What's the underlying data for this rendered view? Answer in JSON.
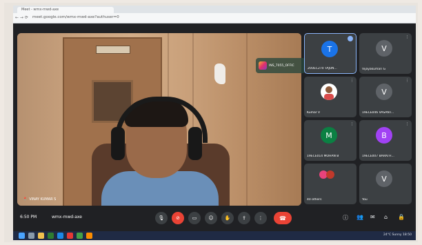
{
  "browser": {
    "tab_title": "Meet - wmx-mwd-axe",
    "url": "meet.google.com/wmx-mwd-axe?authuser=0"
  },
  "main_speaker": {
    "name_label": "VINAY KUMAR S",
    "overlay_label": "INS_7055_OFFIC"
  },
  "participants": [
    {
      "label": "20UEC270 TAJUN...",
      "initial": "T",
      "color": "#1a73e8",
      "speaking": true
    },
    {
      "label": "Vijayakumari G",
      "initial": "V",
      "color": "#5f6368",
      "speaking": false
    },
    {
      "label": "Kumar V",
      "initial": "",
      "color": "#ffffff",
      "speaking": false
    },
    {
      "label": "19ECE046 VASANT...",
      "initial": "V",
      "color": "#5f6368",
      "speaking": false
    },
    {
      "label": "19ECE014 MOHAN B",
      "initial": "M",
      "color": "#0b8043",
      "speaking": false
    },
    {
      "label": "19ECE007 BARATH...",
      "initial": "B",
      "color": "#a142f4",
      "speaking": false
    },
    {
      "label": "40 others",
      "initial": "",
      "color": "#e8437c",
      "speaking": false
    },
    {
      "label": "You",
      "initial": "V",
      "color": "#5f6368",
      "speaking": false
    }
  ],
  "bottom_bar": {
    "time": "6:50 PM",
    "meeting_code": "wmx-mwd-axe"
  },
  "taskbar": {
    "tray_text": "24°C  Sunny",
    "clock": "18:50"
  }
}
